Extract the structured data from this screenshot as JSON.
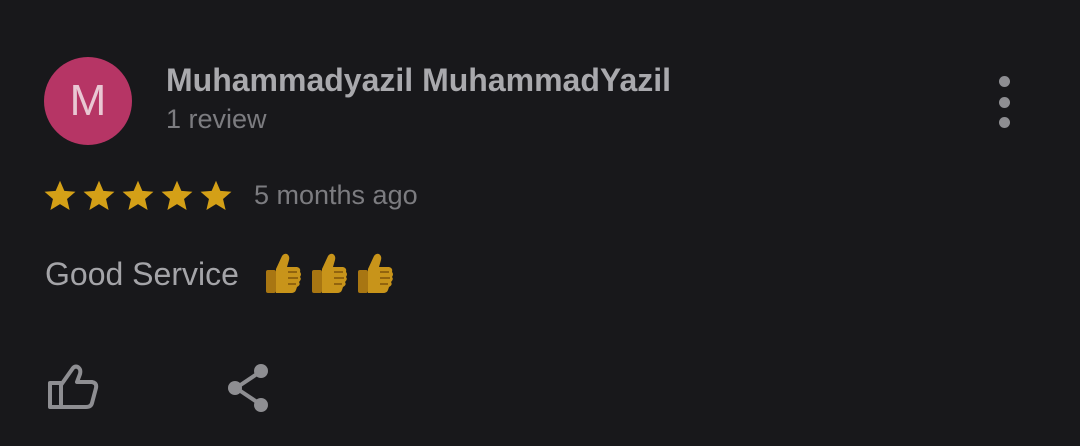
{
  "reviewer": {
    "avatar_letter": "M",
    "avatar_color": "#b63565",
    "name": "Muhammadyazil MuhammadYazil",
    "review_count": "1 review"
  },
  "review": {
    "rating": 5,
    "max_rating": 5,
    "star_color": "#d4a017",
    "time_ago": "5 months ago",
    "text": "Good Service",
    "emojis": [
      "thumbs-up",
      "thumbs-up",
      "thumbs-up"
    ]
  },
  "actions": {
    "more_icon": "more-vertical-icon",
    "like_icon": "thumbs-up-outline-icon",
    "share_icon": "share-icon"
  }
}
